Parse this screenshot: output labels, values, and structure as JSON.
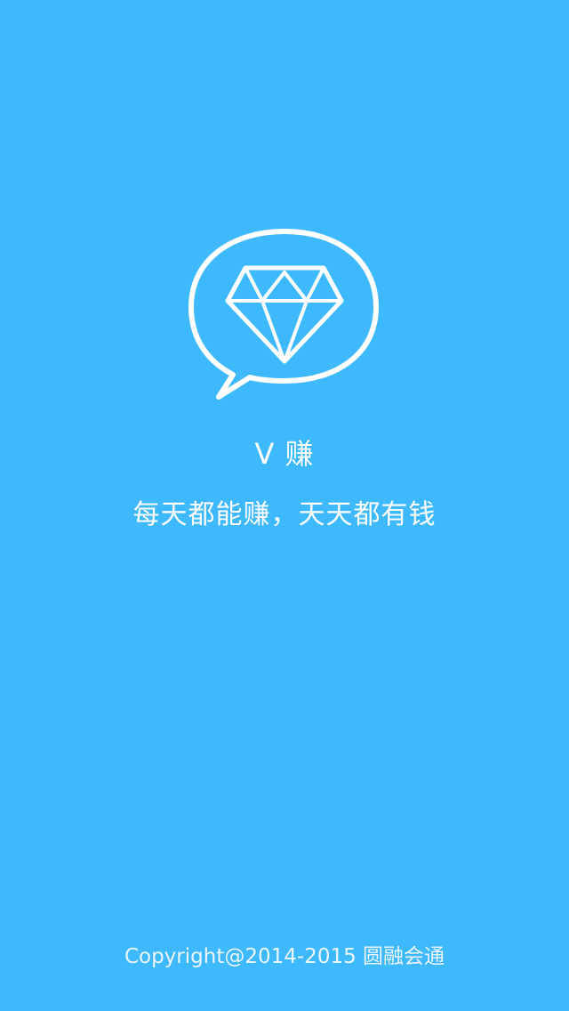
{
  "splash": {
    "logo_icon": "chat-bubble-diamond-icon",
    "app_name": "V 赚",
    "slogan": "每天都能赚，天天都有钱",
    "copyright": "Copyright@2014-2015 圆融会通"
  },
  "colors": {
    "background": "#3fb9fd",
    "foreground": "#ffffff"
  }
}
